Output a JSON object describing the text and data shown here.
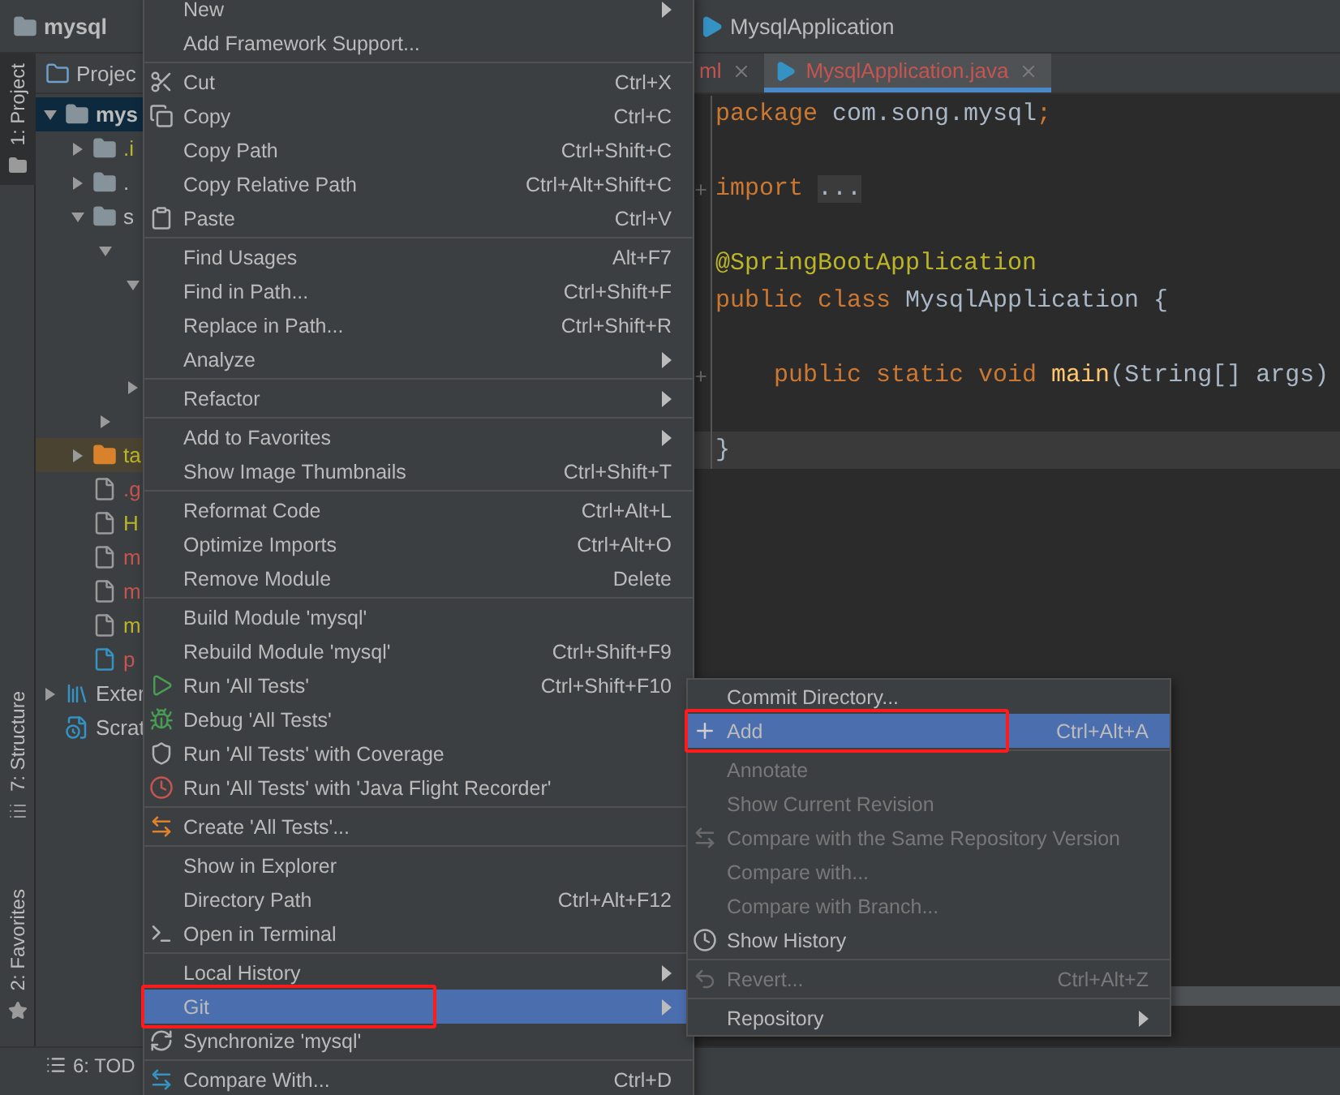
{
  "nav_bar": {
    "project": "mysql",
    "file": "MysqlApplication"
  },
  "tool_strip": {
    "left_top": [
      {
        "label": "1: Project",
        "selected": true
      }
    ],
    "left_bottom": [
      {
        "label": "7: Structure",
        "selected": false
      },
      {
        "label": "2: Favorites",
        "selected": false
      }
    ]
  },
  "project_panel": {
    "title": "Projec",
    "tree": [
      {
        "label": "mys",
        "kind": "module",
        "expanded": true,
        "selected": true,
        "children": [
          {
            "label": ".i",
            "kind": "folder",
            "expanded": false,
            "selected": false,
            "color": "#bbb529"
          },
          {
            "label": ".",
            "kind": "folder",
            "expanded": false,
            "selected": false
          },
          {
            "label": "s",
            "kind": "folder",
            "expanded": true,
            "selected": false,
            "color": "#bbbbbb",
            "children": [
              {
                "expanded": true,
                "selected": false,
                "children": [
                  {
                    "expanded": true,
                    "selected": false,
                    "children": [
                      {
                        "selected": false
                      },
                      {
                        "selected": false
                      }
                    ]
                  },
                  {
                    "expanded": false,
                    "selected": false
                  }
                ]
              },
              {
                "expanded": false,
                "selected": false
              }
            ]
          },
          {
            "label": "ta",
            "kind": "excluded-folder",
            "expanded": false,
            "selected": false,
            "color": "#bbb529"
          },
          {
            "label": ".g",
            "kind": "file",
            "selected": false,
            "color": "#c75450"
          },
          {
            "label": "H",
            "kind": "file",
            "selected": false,
            "color": "#bbb529"
          },
          {
            "label": "m",
            "kind": "file",
            "selected": false,
            "color": "#c75450"
          },
          {
            "label": "m",
            "kind": "file",
            "selected": false,
            "color": "#c75450"
          },
          {
            "label": "m",
            "kind": "file",
            "selected": false,
            "color": "#bbb529"
          },
          {
            "label": "p",
            "kind": "maven",
            "selected": false,
            "color": "#c75450"
          }
        ]
      },
      {
        "label": "Exter",
        "kind": "library",
        "expanded": false,
        "selected": false,
        "color": "#bbbbbb"
      },
      {
        "label": "Scrat",
        "kind": "scratch",
        "selected": false,
        "color": "#bbbbbb"
      }
    ]
  },
  "editor": {
    "tabs": [
      {
        "label": "ml",
        "selected": false
      },
      {
        "label": "MysqlApplication.java",
        "selected": true
      }
    ],
    "lines": [
      {
        "kind": "code",
        "tokens": [
          {
            "text": "package ",
            "kind": "keyword"
          },
          {
            "text": "com.song.mysql",
            "kind": "plain"
          },
          {
            "text": ";",
            "kind": "keyword"
          }
        ]
      },
      {
        "kind": "blank"
      },
      {
        "kind": "code",
        "folded": true,
        "tokens": [
          {
            "text": "import ",
            "kind": "keyword"
          },
          {
            "text": "...",
            "kind": "fold"
          }
        ]
      },
      {
        "kind": "blank"
      },
      {
        "kind": "code",
        "tokens": [
          {
            "text": "@SpringBootApplication",
            "kind": "annotation"
          }
        ]
      },
      {
        "kind": "code",
        "tokens": [
          {
            "text": "public class ",
            "kind": "keyword"
          },
          {
            "text": "MysqlApplication {",
            "kind": "plain"
          }
        ]
      },
      {
        "kind": "blank"
      },
      {
        "kind": "code",
        "folded": true,
        "tokens": [
          {
            "text": "    public static void ",
            "kind": "keyword"
          },
          {
            "text": "main",
            "kind": "method"
          },
          {
            "text": "(String[] args)",
            "kind": "plain"
          }
        ]
      },
      {
        "kind": "blank"
      },
      {
        "kind": "code",
        "current": true,
        "tokens": [
          {
            "text": "}",
            "kind": "plain"
          }
        ]
      }
    ]
  },
  "bottom_bar": {
    "tool": "6: TOD"
  },
  "context_menu": [
    {
      "kind": "item",
      "label": "New",
      "submenu": true,
      "selected": false
    },
    {
      "kind": "item",
      "label": "Add Framework Support...",
      "selected": false
    },
    {
      "kind": "separator"
    },
    {
      "kind": "item",
      "label": "Cut",
      "shortcut": "Ctrl+X",
      "selected": false
    },
    {
      "kind": "item",
      "label": "Copy",
      "shortcut": "Ctrl+C",
      "selected": false
    },
    {
      "kind": "item",
      "label": "Copy Path",
      "shortcut": "Ctrl+Shift+C",
      "selected": false
    },
    {
      "kind": "item",
      "label": "Copy Relative Path",
      "shortcut": "Ctrl+Alt+Shift+C",
      "selected": false
    },
    {
      "kind": "item",
      "label": "Paste",
      "shortcut": "Ctrl+V",
      "selected": false
    },
    {
      "kind": "separator"
    },
    {
      "kind": "item",
      "label": "Find Usages",
      "shortcut": "Alt+F7",
      "selected": false
    },
    {
      "kind": "item",
      "label": "Find in Path...",
      "shortcut": "Ctrl+Shift+F",
      "selected": false
    },
    {
      "kind": "item",
      "label": "Replace in Path...",
      "shortcut": "Ctrl+Shift+R",
      "selected": false
    },
    {
      "kind": "item",
      "label": "Analyze",
      "submenu": true,
      "selected": false
    },
    {
      "kind": "separator"
    },
    {
      "kind": "item",
      "label": "Refactor",
      "submenu": true,
      "selected": false
    },
    {
      "kind": "separator"
    },
    {
      "kind": "item",
      "label": "Add to Favorites",
      "submenu": true,
      "selected": false
    },
    {
      "kind": "item",
      "label": "Show Image Thumbnails",
      "shortcut": "Ctrl+Shift+T",
      "selected": false
    },
    {
      "kind": "separator"
    },
    {
      "kind": "item",
      "label": "Reformat Code",
      "shortcut": "Ctrl+Alt+L",
      "selected": false
    },
    {
      "kind": "item",
      "label": "Optimize Imports",
      "shortcut": "Ctrl+Alt+O",
      "selected": false
    },
    {
      "kind": "item",
      "label": "Remove Module",
      "shortcut": "Delete",
      "selected": false
    },
    {
      "kind": "separator"
    },
    {
      "kind": "item",
      "label": "Build Module 'mysql'",
      "selected": false
    },
    {
      "kind": "item",
      "label": "Rebuild Module 'mysql'",
      "shortcut": "Ctrl+Shift+F9",
      "selected": false
    },
    {
      "kind": "item",
      "label": "Run 'All Tests'",
      "shortcut": "Ctrl+Shift+F10",
      "selected": false
    },
    {
      "kind": "item",
      "label": "Debug 'All Tests'",
      "selected": false
    },
    {
      "kind": "item",
      "label": "Run 'All Tests' with Coverage",
      "selected": false
    },
    {
      "kind": "item",
      "label": "Run 'All Tests' with 'Java Flight Recorder'",
      "selected": false
    },
    {
      "kind": "separator"
    },
    {
      "kind": "item",
      "label": "Create 'All Tests'...",
      "selected": false
    },
    {
      "kind": "separator"
    },
    {
      "kind": "item",
      "label": "Show in Explorer",
      "selected": false
    },
    {
      "kind": "item",
      "label": "Directory Path",
      "shortcut": "Ctrl+Alt+F12",
      "selected": false
    },
    {
      "kind": "item",
      "label": "Open in Terminal",
      "selected": false
    },
    {
      "kind": "separator"
    },
    {
      "kind": "item",
      "label": "Local History",
      "submenu": true,
      "selected": false
    },
    {
      "kind": "item",
      "label": "Git",
      "submenu": true,
      "selected": true,
      "annotated": true
    },
    {
      "kind": "item",
      "label": "Synchronize 'mysql'",
      "selected": false
    },
    {
      "kind": "separator"
    },
    {
      "kind": "item",
      "label": "Compare With...",
      "shortcut": "Ctrl+D",
      "selected": false
    }
  ],
  "git_submenu": [
    {
      "kind": "item",
      "label": "Commit Directory...",
      "selected": false,
      "disabled": false
    },
    {
      "kind": "item",
      "label": "Add",
      "shortcut": "Ctrl+Alt+A",
      "selected": true,
      "disabled": false,
      "annotated": true
    },
    {
      "kind": "separator"
    },
    {
      "kind": "item",
      "label": "Annotate",
      "selected": false,
      "disabled": true
    },
    {
      "kind": "item",
      "label": "Show Current Revision",
      "selected": false,
      "disabled": true
    },
    {
      "kind": "item",
      "label": "Compare with the Same Repository Version",
      "selected": false,
      "disabled": true
    },
    {
      "kind": "item",
      "label": "Compare with...",
      "selected": false,
      "disabled": true
    },
    {
      "kind": "item",
      "label": "Compare with Branch...",
      "selected": false,
      "disabled": true
    },
    {
      "kind": "item",
      "label": "Show History",
      "selected": false,
      "disabled": false
    },
    {
      "kind": "separator"
    },
    {
      "kind": "item",
      "label": "Revert...",
      "shortcut": "Ctrl+Alt+Z",
      "selected": false,
      "disabled": true
    },
    {
      "kind": "separator"
    },
    {
      "kind": "item",
      "label": "Repository",
      "submenu": true,
      "selected": false,
      "disabled": false
    }
  ]
}
